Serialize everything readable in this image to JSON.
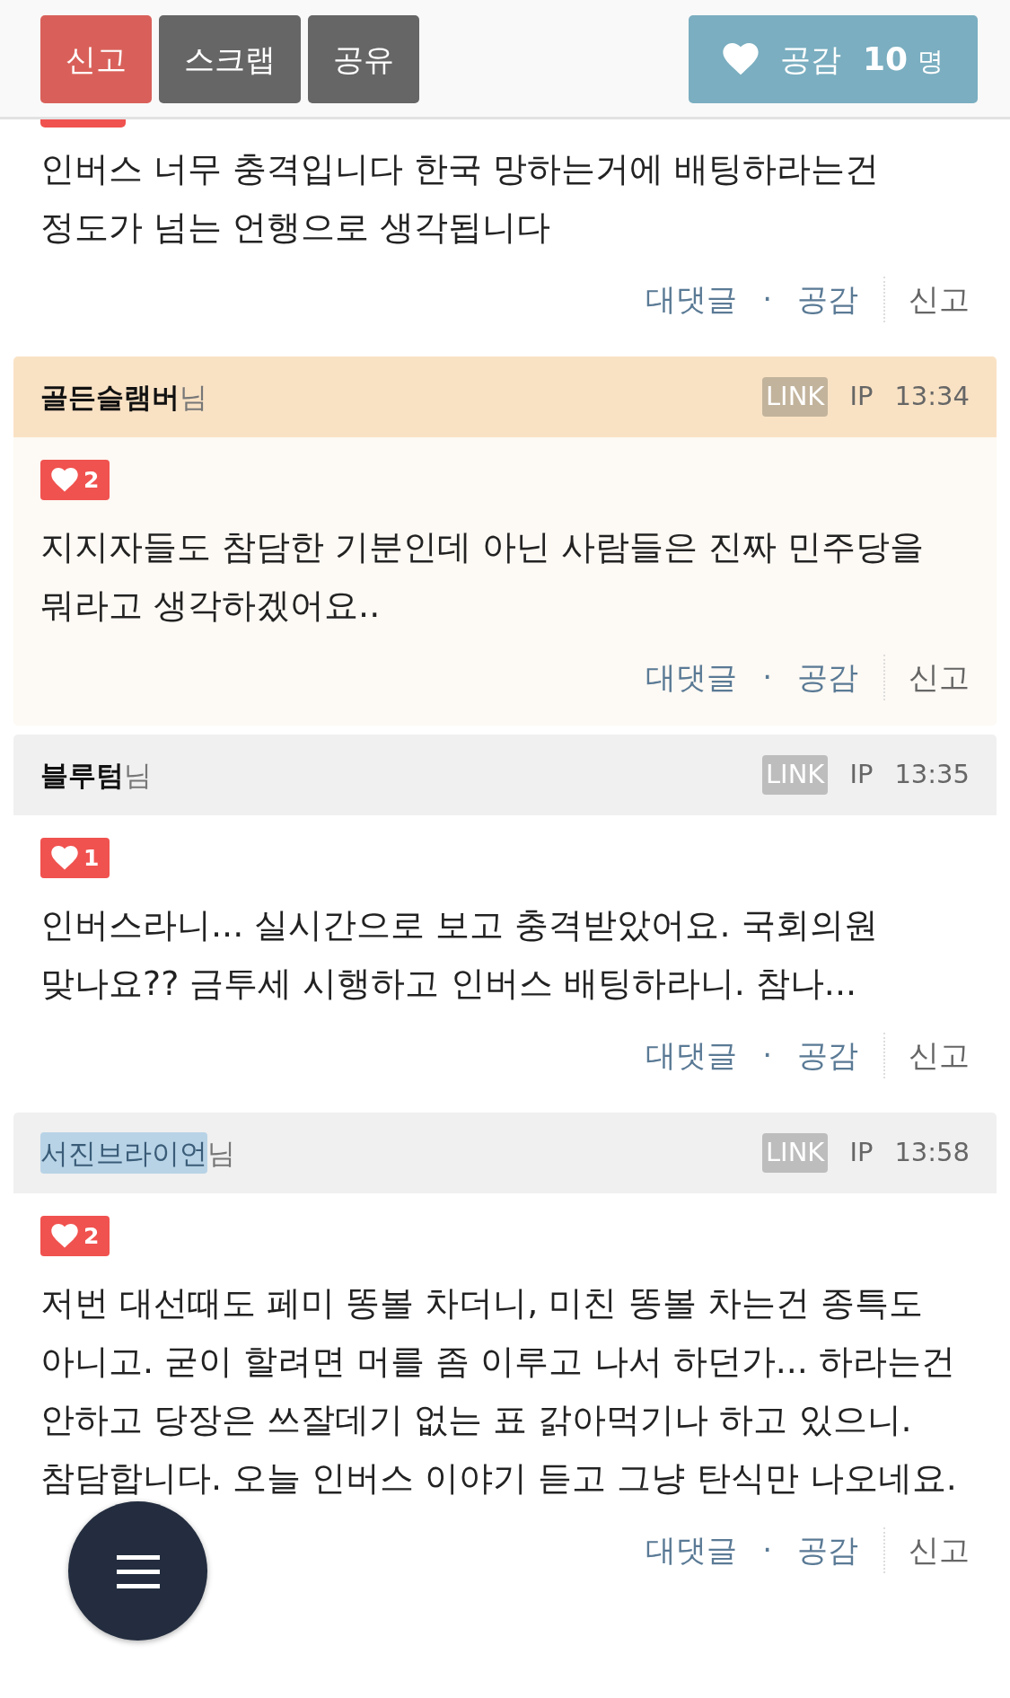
{
  "toolbar": {
    "buttons": [
      {
        "label": "신고",
        "kind": "report"
      },
      {
        "label": "스크랩",
        "kind": "plain"
      },
      {
        "label": "공유",
        "kind": "plain"
      }
    ],
    "like_button": {
      "label": "공감",
      "count": "10",
      "unit": "명"
    }
  },
  "comments": [
    {
      "text": "인버스 너무 충격입니다 한국 망하는거에 배팅하라는건 정도가 넘는 언행으로 생각됩니다",
      "actions": [
        "대댓글",
        "·",
        "공감",
        "신고"
      ]
    },
    {
      "highlighted": true,
      "author": "골든슬램버",
      "author_selected": false,
      "suffix": "님",
      "link": "LINK",
      "ip": "IP",
      "time": "13:34",
      "likes": "2",
      "text": "지지자들도 참담한 기분인데 아닌 사람들은 진짜 민주당을 뭐라고 생각하겠어요..",
      "actions": [
        "대댓글",
        "·",
        "공감",
        "신고"
      ]
    },
    {
      "highlighted": false,
      "author": "블루텀",
      "author_selected": false,
      "suffix": "님",
      "link": "LINK",
      "ip": "IP",
      "time": "13:35",
      "likes": "1",
      "text": "인버스라니... 실시간으로 보고 충격받았어요. 국회의원 맞나요?? 금투세 시행하고 인버스 배팅하라니. 참나...",
      "actions": [
        "대댓글",
        "·",
        "공감",
        "신고"
      ]
    },
    {
      "highlighted": false,
      "author": "서진브라이언",
      "author_selected": true,
      "suffix": "님",
      "link": "LINK",
      "ip": "IP",
      "time": "13:58",
      "likes": "2",
      "text": "저번 대선때도 페미 똥볼 차더니, 미친 똥볼 차는건 종특도 아니고. 굳이 할려면 머를 좀 이루고 나서 하던가... 하라는건 안하고 당장은 쓰잘데기 없는 표 갉아먹기나 하고 있으니. 참담합니다. 오늘 인버스 이야기 듣고 그냥 탄식만 나오네요.",
      "actions": [
        "대댓글",
        "·",
        "공감",
        "신고"
      ]
    }
  ]
}
